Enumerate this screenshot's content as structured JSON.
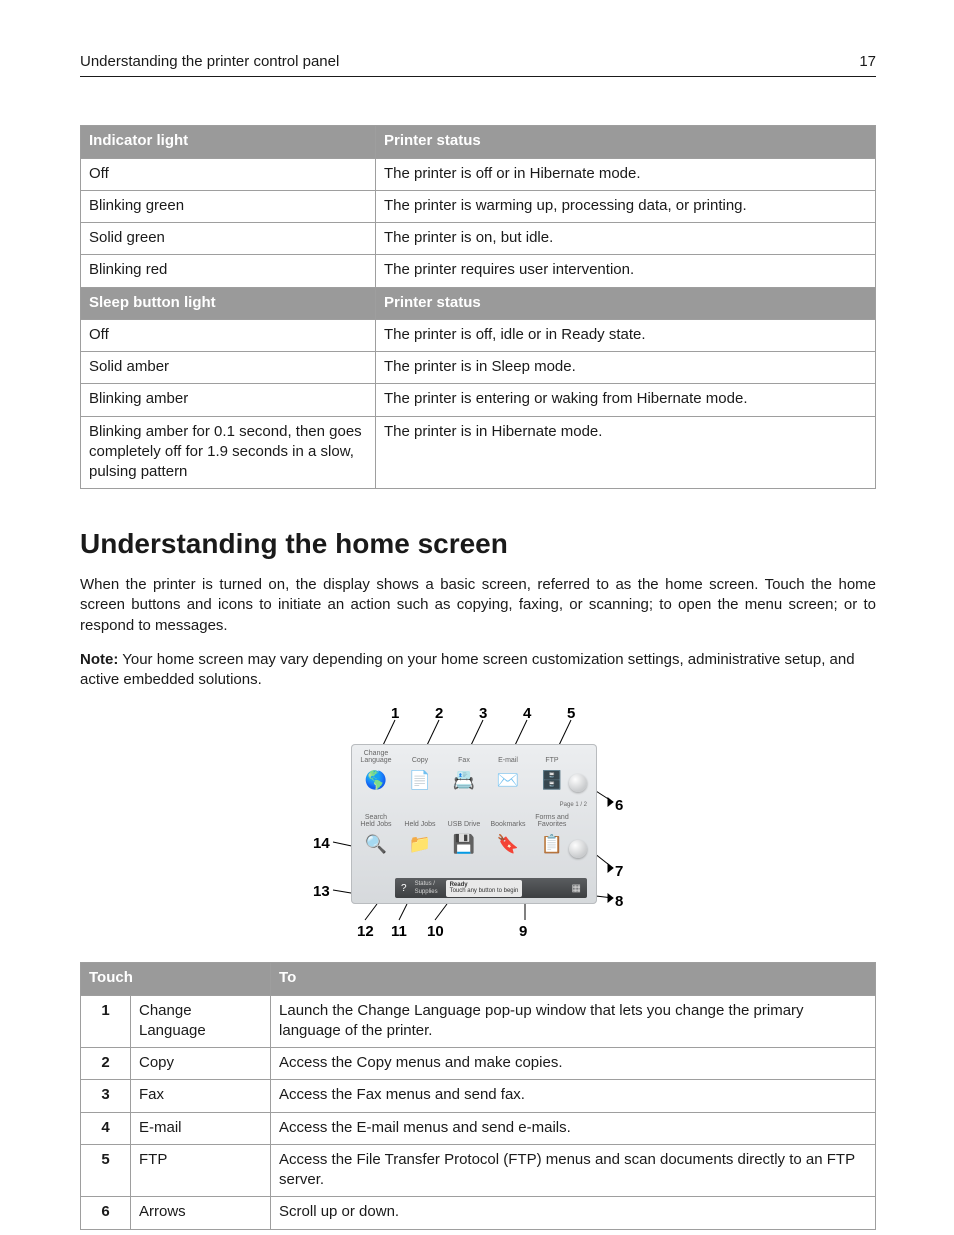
{
  "header": {
    "title": "Understanding the printer control panel",
    "page_number": "17"
  },
  "indicator_table": {
    "headers": [
      "Indicator light",
      "Printer status"
    ],
    "rows": [
      [
        "Off",
        "The printer is off or in Hibernate mode."
      ],
      [
        "Blinking green",
        "The printer is warming up, processing data, or printing."
      ],
      [
        "Solid green",
        "The printer is on, but idle."
      ],
      [
        "Blinking red",
        "The printer requires user intervention."
      ]
    ]
  },
  "sleep_table": {
    "headers": [
      "Sleep button light",
      "Printer status"
    ],
    "rows": [
      [
        "Off",
        "The printer is off, idle or in Ready state."
      ],
      [
        "Solid amber",
        "The printer is in Sleep mode."
      ],
      [
        "Blinking amber",
        "The printer is entering or waking from Hibernate mode."
      ],
      [
        "Blinking amber for 0.1 second, then goes completely off for 1.9 seconds in a slow, pulsing pattern",
        "The printer is in Hibernate mode."
      ]
    ]
  },
  "section": {
    "heading": "Understanding the home screen",
    "para1": "When the printer is turned on, the display shows a basic screen, referred to as the home screen. Touch the home screen buttons and icons to initiate an action such as copying, faxing, or scanning; to open the menu screen; or to respond to messages.",
    "note_label": "Note:",
    "note_body": " Your home screen may vary depending on your home screen customization settings, administrative setup, and active embedded solutions."
  },
  "figure": {
    "callouts_top": [
      "1",
      "2",
      "3",
      "4",
      "5"
    ],
    "callouts_right": [
      "6",
      "7",
      "8"
    ],
    "callouts_left": [
      "14",
      "13"
    ],
    "callouts_bottom": [
      "12",
      "11",
      "10",
      "9"
    ],
    "row1_labels": [
      "Change\nLanguage",
      "Copy",
      "Fax",
      "E-mail",
      "FTP"
    ],
    "row2_labels": [
      "Search\nHeld Jobs",
      "Held Jobs",
      "USB Drive",
      "Bookmarks",
      "Forms and\nFavorites"
    ],
    "page_indicator": "Page\n1 / 2",
    "status_left": "Status /\nSupplies",
    "status_ready_top": "Ready",
    "status_ready_bottom": "Touch any button to begin"
  },
  "touch_table": {
    "headers": [
      "Touch",
      "To"
    ],
    "rows": [
      {
        "n": "1",
        "name": "Change Language",
        "to": "Launch the Change Language pop‑up window that lets you change the primary language of the printer."
      },
      {
        "n": "2",
        "name": "Copy",
        "to": "Access the Copy menus and make copies."
      },
      {
        "n": "3",
        "name": "Fax",
        "to": "Access the Fax menus and send fax."
      },
      {
        "n": "4",
        "name": "E-mail",
        "to": "Access the E-mail menus and send e-mails."
      },
      {
        "n": "5",
        "name": "FTP",
        "to": "Access the File Transfer Protocol (FTP) menus and scan documents directly to an FTP server."
      },
      {
        "n": "6",
        "name": "Arrows",
        "to": "Scroll up or down."
      }
    ]
  }
}
